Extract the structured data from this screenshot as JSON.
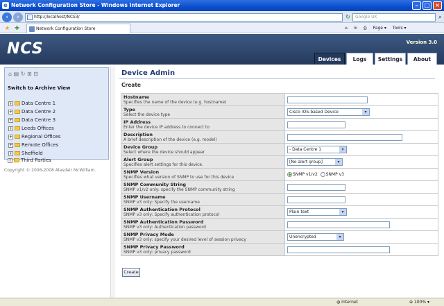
{
  "window": {
    "title": "Network Configuration Store - Windows Internet Explorer"
  },
  "browser": {
    "url": "http://localhost/NCS3/",
    "search_placeholder": "Google UK",
    "tab_title": "Network Configuration Store",
    "tools": {
      "page": "Page ▾",
      "tools": "Tools ▾"
    },
    "status": {
      "zone": "Internet",
      "zoom": "100%"
    }
  },
  "app": {
    "logo": "NCS",
    "version": "Version 3.0",
    "tabs": [
      {
        "label": "Devices"
      },
      {
        "label": "Logs"
      },
      {
        "label": "Settings"
      },
      {
        "label": "About"
      }
    ]
  },
  "sidebar": {
    "archive_label": "Switch to Archive View",
    "items": [
      {
        "label": "Data Centre 1"
      },
      {
        "label": "Data Centre 2"
      },
      {
        "label": "Data Centre 3"
      },
      {
        "label": "Leeds Offices"
      },
      {
        "label": "Regional Offices"
      },
      {
        "label": "Remote Offices"
      },
      {
        "label": "Sheffield"
      },
      {
        "label": "Third Parties"
      }
    ],
    "copyright": "Copyright © 2006-2008 Alasdair McWilliam."
  },
  "main": {
    "title": "Device Admin",
    "subtitle": "Create",
    "fields": [
      {
        "label": "Hostname",
        "desc": "Specifies the name of the device (e.g. hostname)"
      },
      {
        "label": "Type",
        "desc": "Select the device type",
        "value": "Cisco IOS-based Device"
      },
      {
        "label": "IP Address",
        "desc": "Enter the device IP address to connect to"
      },
      {
        "label": "Description",
        "desc": "A brief description of the device (e.g. model)"
      },
      {
        "label": "Device Group",
        "desc": "Select where the device should appear",
        "value": "- Data Centre 1"
      },
      {
        "label": "Alert Group",
        "desc": "Specifies alert settings for this device.",
        "value": "[No alert group]"
      },
      {
        "label": "SNMP Version",
        "desc": "Specifies what version of SNMP to use for this device",
        "options": [
          "SNMP v1/v2",
          "SNMP v3"
        ]
      },
      {
        "label": "SNMP Community String",
        "desc": "SNMP v1/v2 only: specify the SNMP community string"
      },
      {
        "label": "SNMP Username",
        "desc": "SNMP v3 only: Specify the username"
      },
      {
        "label": "SNMP Authentication Protocol",
        "desc": "SNMP v3 only: Specify authentication protocol",
        "value": "Plain text"
      },
      {
        "label": "SNMP Authentication Password",
        "desc": "SNMP v3 only: Authentication password"
      },
      {
        "label": "SNMP Privacy Mode",
        "desc": "SNMP v3 only: specify your desired level of session privacy",
        "value": "Unencrypted"
      },
      {
        "label": "SNMP Privacy Password",
        "desc": "SNMP v3 only: privacy password"
      }
    ],
    "submit_label": "Create"
  }
}
